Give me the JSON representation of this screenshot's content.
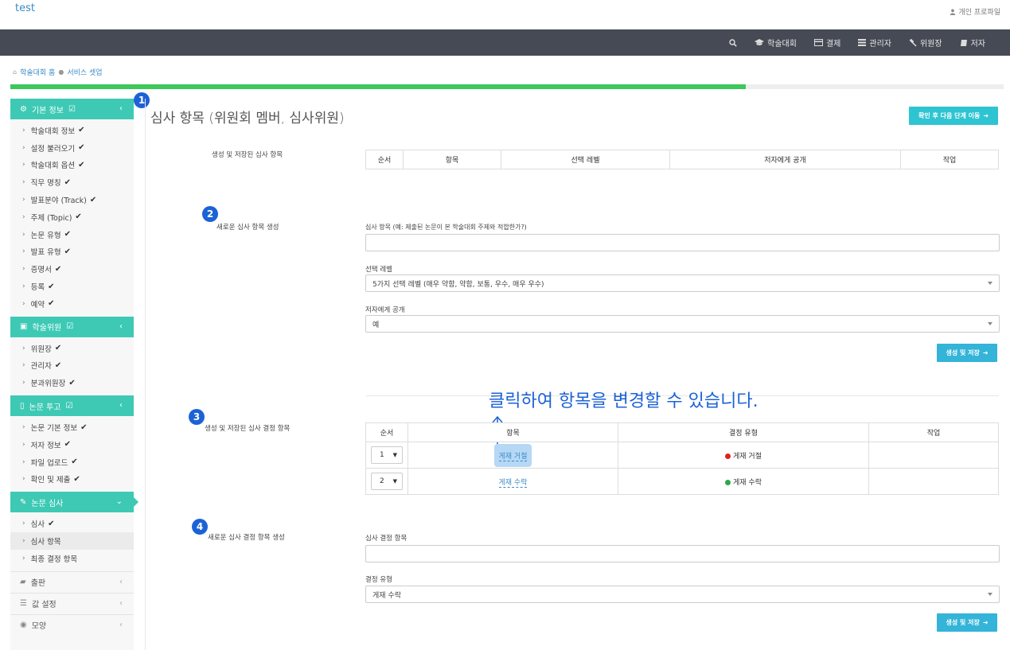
{
  "header": {
    "brand": "test",
    "profile_label": "개인 프로파일"
  },
  "nav": {
    "items": [
      {
        "label": "학술대회",
        "icon": "graduation-cap-icon"
      },
      {
        "label": "결제",
        "icon": "credit-card-icon"
      },
      {
        "label": "관리자",
        "icon": "list-icon"
      },
      {
        "label": "위원장",
        "icon": "gavel-icon"
      },
      {
        "label": "저자",
        "icon": "book-icon"
      }
    ]
  },
  "breadcrumb": {
    "home": "학술대회 홈",
    "current": "서비스 셋업"
  },
  "progress": {
    "fraction": 0.74,
    "color": "#3cc85a"
  },
  "sidebar": {
    "sections": [
      {
        "title": "기본 정보",
        "items": [
          "학술대회 정보",
          "설정 불러오기",
          "학술대회 옵션",
          "직무 명칭",
          "발표분야 (Track)",
          "주제 (Topic)",
          "논문 유형",
          "발표 유형",
          "증명서",
          "등록",
          "예약"
        ]
      },
      {
        "title": "학술위원",
        "items": [
          "위원장",
          "관리자",
          "분과위원장"
        ]
      },
      {
        "title": "논문 투고",
        "items": [
          "논문 기본 정보",
          "저자 정보",
          "파일 업로드",
          "확인 및 제출"
        ]
      },
      {
        "title": "논문 심사",
        "items": [
          "심사",
          "심사 항목",
          "최종 결정 항목"
        ]
      }
    ],
    "plain_sections": [
      "출판",
      "값 설정",
      "모양"
    ]
  },
  "main": {
    "title": "심사 항목 (위원회 멤버, 심사위원)",
    "next_button": "확인 후 다음 단계 이동",
    "saved_items_label": "생성 및 저장된 심사 항목",
    "saved_items_table": {
      "headers": [
        "순서",
        "항목",
        "선택 레벨",
        "저자에게 공개",
        "작업"
      ]
    },
    "new_item_label": "새로운 심사 항목 생성",
    "new_item_form": {
      "item_label": "심사 항목 (예: 제출된 논문이 본 학술대회 주제와 적합한가?)",
      "level_label": "선택 레벨",
      "level_value": "5가지 선택 레벨 (매우 약함, 약함, 보통, 우수, 매우 우수)",
      "public_label": "저자에게 공개",
      "public_value": "예",
      "submit": "생성 및 저장"
    },
    "callout": "클릭하여 항목을 변경할 수 있습니다.",
    "saved_decision_label": "생성 및 저장된 심사 결정 항목",
    "decision_table": {
      "headers": [
        "순서",
        "항목",
        "결정 유형",
        "작업"
      ],
      "rows": [
        {
          "order": "1",
          "item": "게재 거절",
          "type": "게재 거절",
          "color": "#e02020"
        },
        {
          "order": "2",
          "item": "게재 수락",
          "type": "게재 수락",
          "color": "#2aa84a"
        }
      ]
    },
    "new_decision_label": "새로운 심사 결정 항목 생성",
    "new_decision_form": {
      "item_label": "심사 결정 항목",
      "type_label": "결정 유형",
      "type_value": "게재 수락",
      "submit": "생성 및 저장"
    },
    "badges": [
      "1",
      "2",
      "3",
      "4"
    ]
  }
}
